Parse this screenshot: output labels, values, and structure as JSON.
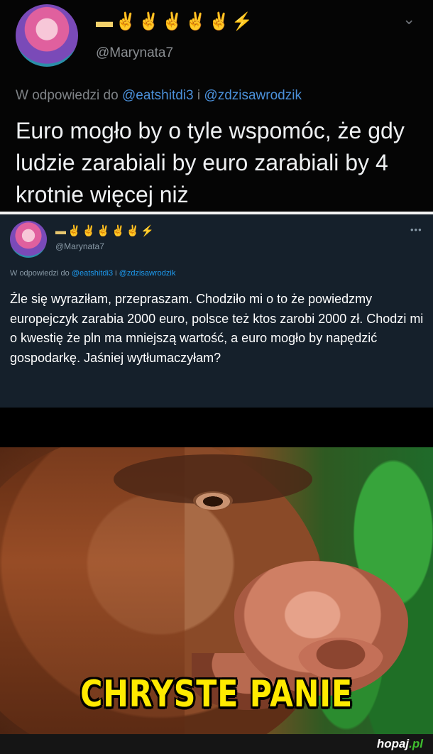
{
  "tweet1": {
    "emoji_line": "▬✌✌✌✌✌⚡",
    "handle": "@Marynata7",
    "reply_prefix": "W odpowiedzi do",
    "mention1": "@eatshitdi3",
    "reply_join": "i",
    "mention2": "@zdzisawrodzik",
    "text": "Euro mogło by o tyle wspomóc, że gdy ludzie zarabiali by euro zarabiali by 4 krotnie więcej niż"
  },
  "tweet2": {
    "emoji_line": "▬✌✌✌✌✌⚡",
    "handle": "@Marynata7",
    "reply_prefix": "W odpowiedzi do",
    "mention1": "@eatshitdi3",
    "reply_join": "i",
    "mention2": "@zdzisawrodzik",
    "text": "Źle się wyraziłam, przepraszam. Chodziło mi o to że powiedzmy  europejczyk zarabia 2000 euro,  polsce też ktos zarobi 2000 zł. Chodzi mi o kwestię że pln ma mniejszą wartość, a euro mogło by napędzić gospodarkę. Jaśniej wytłumaczyłam?"
  },
  "meme": {
    "caption": "CHRYSTE PANIE"
  },
  "footer": {
    "logo_main": "hopaj",
    "logo_dot": ".",
    "logo_tld": "pl"
  },
  "colors": {
    "mention_dark": "#4b90d9",
    "mention_dim": "#1d9bf0",
    "caption": "#ffea00",
    "logo_accent": "#3fbf2f"
  },
  "icons": {
    "more": "chevron-down-icon",
    "overflow": "more-dots-icon"
  }
}
